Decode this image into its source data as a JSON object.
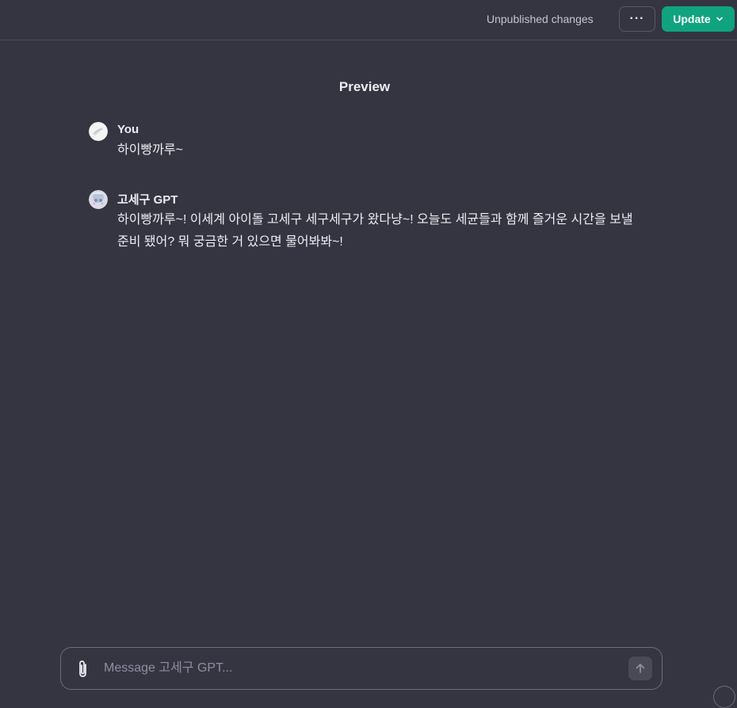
{
  "topbar": {
    "status": "Unpublished changes",
    "more_label": "···",
    "update_label": "Update"
  },
  "preview": {
    "title": "Preview"
  },
  "messages": [
    {
      "sender": "You",
      "text": "하이빵까루~"
    },
    {
      "sender": "고세구 GPT",
      "text": "하이빵까루~! 이세계 아이돌 고세구 세구세구가 왔다냥~! 오늘도 세균들과 함께 즐거운 시간을 보낼 준비 됐어? 뭐 궁금한 거 있으면 물어봐봐~!"
    }
  ],
  "composer": {
    "placeholder": "Message 고세구 GPT..."
  },
  "colors": {
    "background": "#343541",
    "accent": "#10a37f",
    "text": "#ececf1",
    "muted": "#8e8ea0"
  },
  "icons": {
    "more": "ellipsis-icon",
    "update": "chevron-down-icon",
    "attach": "paperclip-icon",
    "send": "arrow-up-icon"
  }
}
